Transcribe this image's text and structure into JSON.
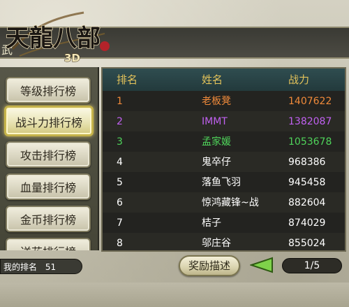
{
  "header": {
    "partial_label": "武",
    "logo_text": "天龍八部",
    "logo_sub": "3D"
  },
  "tabs": [
    {
      "label": "等级排行榜",
      "active": false
    },
    {
      "label": "战斗力排行榜",
      "active": true
    },
    {
      "label": "攻击排行榜",
      "active": false
    },
    {
      "label": "血量排行榜",
      "active": false
    },
    {
      "label": "金币排行榜",
      "active": false
    },
    {
      "label": "送花排行榜",
      "active": false
    }
  ],
  "table": {
    "columns": [
      "排名",
      "姓名",
      "战力"
    ],
    "rows": [
      {
        "rank": "1",
        "name": "老板凳",
        "power": "1407622",
        "color": "#f08a3a"
      },
      {
        "rank": "2",
        "name": "IMMT",
        "power": "1382087",
        "color": "#c060f0"
      },
      {
        "rank": "3",
        "name": "孟家媛",
        "power": "1053678",
        "color": "#4fd35a"
      },
      {
        "rank": "4",
        "name": "鬼卒仔",
        "power": "968386",
        "color": "#ffffff"
      },
      {
        "rank": "5",
        "name": "落鱼飞羽",
        "power": "945458",
        "color": "#ffffff"
      },
      {
        "rank": "6",
        "name": "惊鸿藏锋~战",
        "power": "882604",
        "color": "#ffffff"
      },
      {
        "rank": "7",
        "name": "桔子",
        "power": "874029",
        "color": "#ffffff"
      },
      {
        "rank": "8",
        "name": "邬庄谷",
        "power": "855024",
        "color": "#ffffff"
      }
    ]
  },
  "footer": {
    "my_rank_label": "我的排名",
    "my_rank_value": "51",
    "reward_button": "奖励描述",
    "page_indicator": "1/5"
  },
  "colors": {
    "header_text": "#e4c35a",
    "active_tab_border": "#c5b34a"
  }
}
